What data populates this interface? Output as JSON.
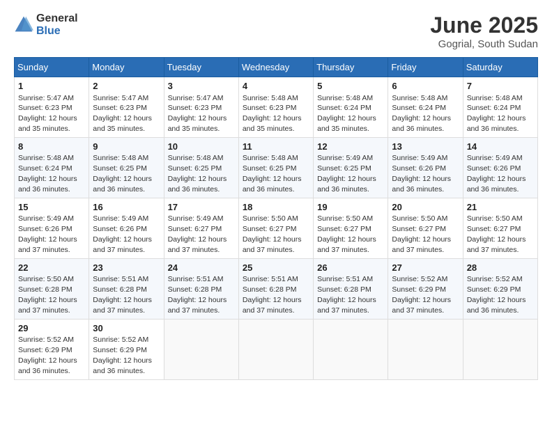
{
  "header": {
    "logo_general": "General",
    "logo_blue": "Blue",
    "month_title": "June 2025",
    "location": "Gogrial, South Sudan"
  },
  "days_of_week": [
    "Sunday",
    "Monday",
    "Tuesday",
    "Wednesday",
    "Thursday",
    "Friday",
    "Saturday"
  ],
  "weeks": [
    [
      {
        "day": "1",
        "sunrise": "5:47 AM",
        "sunset": "6:23 PM",
        "daylight": "12 hours and 35 minutes."
      },
      {
        "day": "2",
        "sunrise": "5:47 AM",
        "sunset": "6:23 PM",
        "daylight": "12 hours and 35 minutes."
      },
      {
        "day": "3",
        "sunrise": "5:47 AM",
        "sunset": "6:23 PM",
        "daylight": "12 hours and 35 minutes."
      },
      {
        "day": "4",
        "sunrise": "5:48 AM",
        "sunset": "6:23 PM",
        "daylight": "12 hours and 35 minutes."
      },
      {
        "day": "5",
        "sunrise": "5:48 AM",
        "sunset": "6:24 PM",
        "daylight": "12 hours and 35 minutes."
      },
      {
        "day": "6",
        "sunrise": "5:48 AM",
        "sunset": "6:24 PM",
        "daylight": "12 hours and 36 minutes."
      },
      {
        "day": "7",
        "sunrise": "5:48 AM",
        "sunset": "6:24 PM",
        "daylight": "12 hours and 36 minutes."
      }
    ],
    [
      {
        "day": "8",
        "sunrise": "5:48 AM",
        "sunset": "6:24 PM",
        "daylight": "12 hours and 36 minutes."
      },
      {
        "day": "9",
        "sunrise": "5:48 AM",
        "sunset": "6:25 PM",
        "daylight": "12 hours and 36 minutes."
      },
      {
        "day": "10",
        "sunrise": "5:48 AM",
        "sunset": "6:25 PM",
        "daylight": "12 hours and 36 minutes."
      },
      {
        "day": "11",
        "sunrise": "5:48 AM",
        "sunset": "6:25 PM",
        "daylight": "12 hours and 36 minutes."
      },
      {
        "day": "12",
        "sunrise": "5:49 AM",
        "sunset": "6:25 PM",
        "daylight": "12 hours and 36 minutes."
      },
      {
        "day": "13",
        "sunrise": "5:49 AM",
        "sunset": "6:26 PM",
        "daylight": "12 hours and 36 minutes."
      },
      {
        "day": "14",
        "sunrise": "5:49 AM",
        "sunset": "6:26 PM",
        "daylight": "12 hours and 36 minutes."
      }
    ],
    [
      {
        "day": "15",
        "sunrise": "5:49 AM",
        "sunset": "6:26 PM",
        "daylight": "12 hours and 37 minutes."
      },
      {
        "day": "16",
        "sunrise": "5:49 AM",
        "sunset": "6:26 PM",
        "daylight": "12 hours and 37 minutes."
      },
      {
        "day": "17",
        "sunrise": "5:49 AM",
        "sunset": "6:27 PM",
        "daylight": "12 hours and 37 minutes."
      },
      {
        "day": "18",
        "sunrise": "5:50 AM",
        "sunset": "6:27 PM",
        "daylight": "12 hours and 37 minutes."
      },
      {
        "day": "19",
        "sunrise": "5:50 AM",
        "sunset": "6:27 PM",
        "daylight": "12 hours and 37 minutes."
      },
      {
        "day": "20",
        "sunrise": "5:50 AM",
        "sunset": "6:27 PM",
        "daylight": "12 hours and 37 minutes."
      },
      {
        "day": "21",
        "sunrise": "5:50 AM",
        "sunset": "6:27 PM",
        "daylight": "12 hours and 37 minutes."
      }
    ],
    [
      {
        "day": "22",
        "sunrise": "5:50 AM",
        "sunset": "6:28 PM",
        "daylight": "12 hours and 37 minutes."
      },
      {
        "day": "23",
        "sunrise": "5:51 AM",
        "sunset": "6:28 PM",
        "daylight": "12 hours and 37 minutes."
      },
      {
        "day": "24",
        "sunrise": "5:51 AM",
        "sunset": "6:28 PM",
        "daylight": "12 hours and 37 minutes."
      },
      {
        "day": "25",
        "sunrise": "5:51 AM",
        "sunset": "6:28 PM",
        "daylight": "12 hours and 37 minutes."
      },
      {
        "day": "26",
        "sunrise": "5:51 AM",
        "sunset": "6:28 PM",
        "daylight": "12 hours and 37 minutes."
      },
      {
        "day": "27",
        "sunrise": "5:52 AM",
        "sunset": "6:29 PM",
        "daylight": "12 hours and 37 minutes."
      },
      {
        "day": "28",
        "sunrise": "5:52 AM",
        "sunset": "6:29 PM",
        "daylight": "12 hours and 36 minutes."
      }
    ],
    [
      {
        "day": "29",
        "sunrise": "5:52 AM",
        "sunset": "6:29 PM",
        "daylight": "12 hours and 36 minutes."
      },
      {
        "day": "30",
        "sunrise": "5:52 AM",
        "sunset": "6:29 PM",
        "daylight": "12 hours and 36 minutes."
      },
      null,
      null,
      null,
      null,
      null
    ]
  ],
  "labels": {
    "sunrise": "Sunrise:",
    "sunset": "Sunset:",
    "daylight": "Daylight:"
  }
}
